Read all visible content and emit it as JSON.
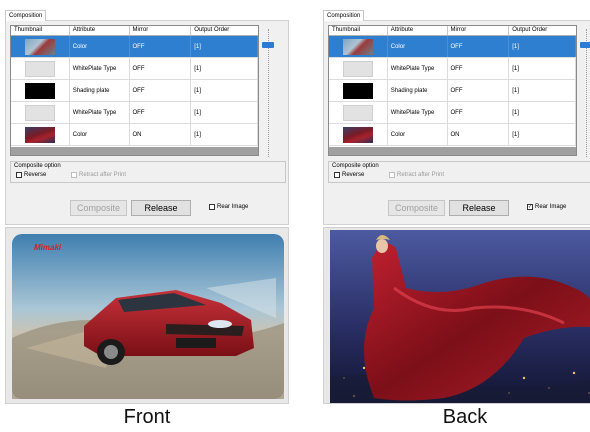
{
  "panels": [
    {
      "tab_label": "Composition",
      "columns": [
        "Thumbnail",
        "Attribute",
        "Mirror",
        "Output Order"
      ],
      "rows": [
        {
          "thumbnail": "car-photo",
          "attribute": "Color",
          "mirror": "OFF",
          "order": "[1]",
          "selected": true
        },
        {
          "thumbnail": "white-plate",
          "attribute": "WhitePlate Type",
          "mirror": "OFF",
          "order": "[1]",
          "selected": false
        },
        {
          "thumbnail": "black-plate",
          "attribute": "Shading plate",
          "mirror": "OFF",
          "order": "[1]",
          "selected": false
        },
        {
          "thumbnail": "white-plate",
          "attribute": "WhitePlate Type",
          "mirror": "OFF",
          "order": "[1]",
          "selected": false
        },
        {
          "thumbnail": "dress-photo",
          "attribute": "Color",
          "mirror": "ON",
          "order": "[1]",
          "selected": false
        }
      ],
      "composite_option": {
        "title": "Composite option",
        "reverse_label": "Reverse",
        "reverse_checked": false,
        "retract_label": "Retract after Print",
        "retract_checked": false
      },
      "composite_label": "Composite",
      "release_label": "Release",
      "rear_image_label": "Rear Image",
      "rear_image_checked": false,
      "preview_logo": "Mimaki",
      "caption": "Front"
    },
    {
      "tab_label": "Composition",
      "columns": [
        "Thumbnail",
        "Attribute",
        "Mirror",
        "Output Order"
      ],
      "rows": [
        {
          "thumbnail": "car-photo",
          "attribute": "Color",
          "mirror": "OFF",
          "order": "[1]",
          "selected": true
        },
        {
          "thumbnail": "white-plate",
          "attribute": "WhitePlate Type",
          "mirror": "OFF",
          "order": "[1]",
          "selected": false
        },
        {
          "thumbnail": "black-plate",
          "attribute": "Shading plate",
          "mirror": "OFF",
          "order": "[1]",
          "selected": false
        },
        {
          "thumbnail": "white-plate",
          "attribute": "WhitePlate Type",
          "mirror": "OFF",
          "order": "[1]",
          "selected": false
        },
        {
          "thumbnail": "dress-photo",
          "attribute": "Color",
          "mirror": "ON",
          "order": "[1]",
          "selected": false
        }
      ],
      "composite_option": {
        "title": "Composite option",
        "reverse_label": "Reverse",
        "reverse_checked": false,
        "retract_label": "Retract after Print",
        "retract_checked": false
      },
      "composite_label": "Composite",
      "release_label": "Release",
      "rear_image_label": "Rear Image",
      "rear_image_checked": true,
      "caption": "Back"
    }
  ],
  "colors": {
    "selection": "#2f7fd0",
    "slider": "#2b7bd4",
    "logo": "#d42020"
  }
}
